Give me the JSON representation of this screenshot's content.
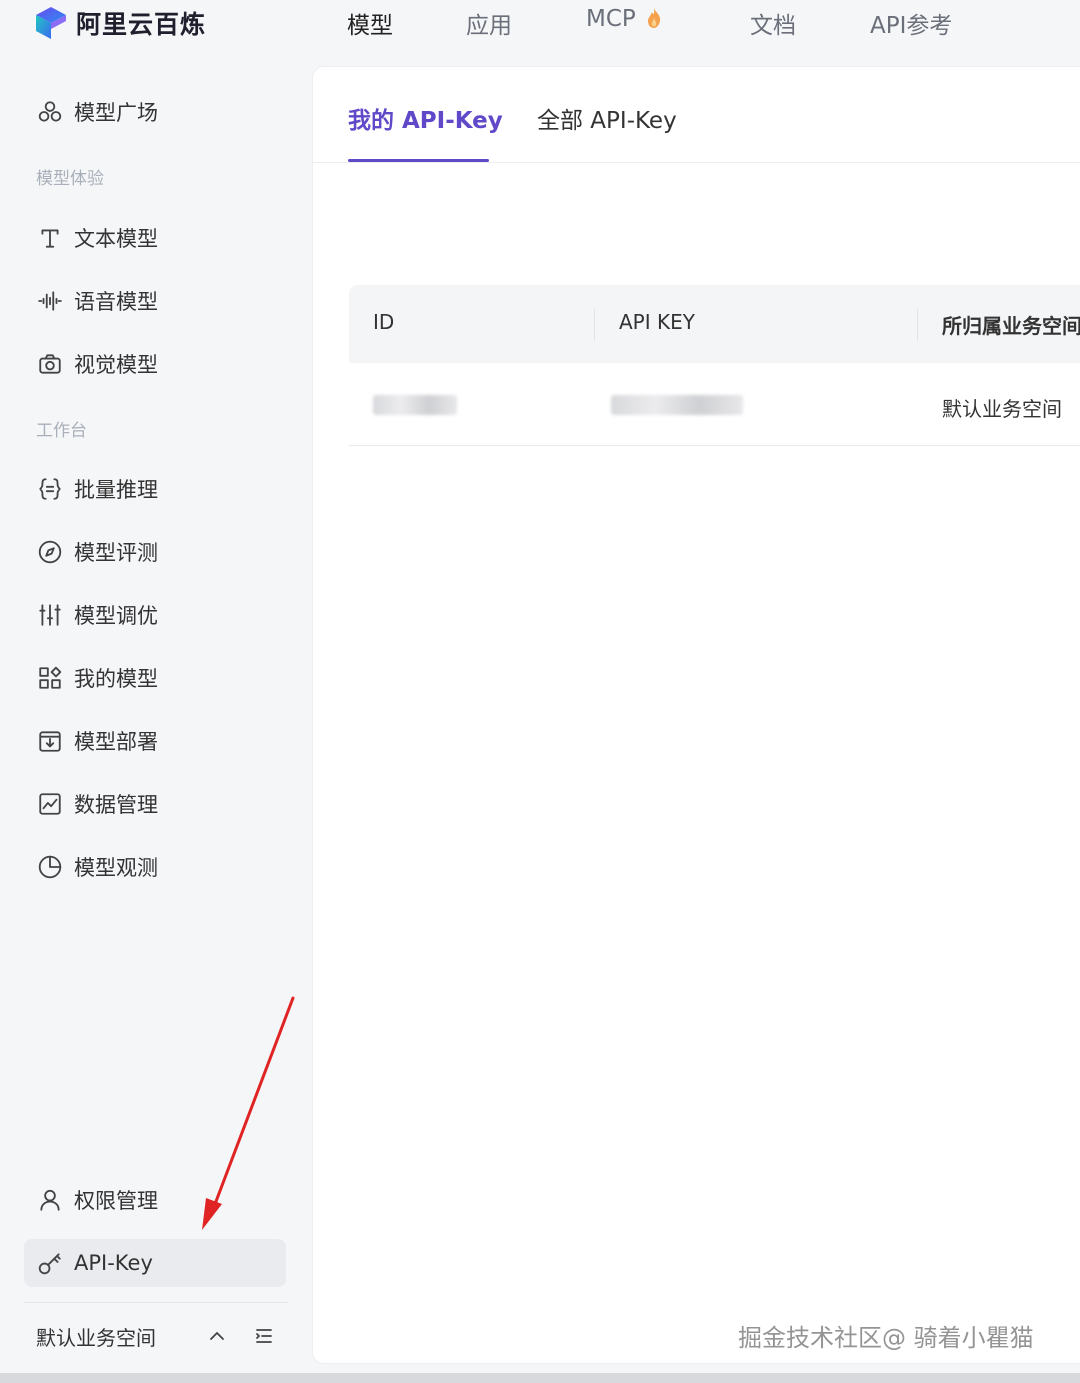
{
  "app": {
    "name": "阿里云百炼"
  },
  "top_nav": [
    {
      "label": "模型",
      "active": true
    },
    {
      "label": "应用",
      "active": false
    },
    {
      "label": "MCP",
      "active": false,
      "badge_icon": "flame-icon"
    },
    {
      "label": "文档",
      "active": false
    },
    {
      "label": "API参考",
      "active": false
    }
  ],
  "sidebar": {
    "top_item": {
      "label": "模型广场",
      "icon": "model-square-icon"
    },
    "group1": "模型体验",
    "group1_items": [
      {
        "label": "文本模型",
        "icon": "text-icon"
      },
      {
        "label": "语音模型",
        "icon": "audio-wave-icon"
      },
      {
        "label": "视觉模型",
        "icon": "camera-icon"
      }
    ],
    "group2": "工作台",
    "group2_items": [
      {
        "label": "批量推理",
        "icon": "braces-icon"
      },
      {
        "label": "模型评测",
        "icon": "compass-icon"
      },
      {
        "label": "模型调优",
        "icon": "sliders-icon"
      },
      {
        "label": "我的模型",
        "icon": "apps-icon"
      },
      {
        "label": "模型部署",
        "icon": "deploy-icon"
      },
      {
        "label": "数据管理",
        "icon": "chart-icon"
      },
      {
        "label": "模型观测",
        "icon": "pie-chart-icon"
      }
    ],
    "bottom_items": [
      {
        "label": "权限管理",
        "icon": "user-icon"
      },
      {
        "label": "API-Key",
        "icon": "key-icon",
        "selected": true
      }
    ],
    "workspace": "默认业务空间"
  },
  "main": {
    "tabs": [
      {
        "label": "我的 API-Key",
        "active": true
      },
      {
        "label": "全部 API-Key",
        "active": false
      }
    ],
    "table": {
      "headers": [
        "ID",
        "API KEY",
        "所归属业务空间"
      ],
      "rows": [
        {
          "id": "(blurred)",
          "api_key": "(blurred)",
          "workspace": "默认业务空间"
        }
      ]
    }
  },
  "watermark": "掘金技术社区@ 骑着小瞿猫",
  "colors": {
    "accent": "#6048c8",
    "arrow": "#e02424",
    "sidebar_bg": "#f5f6f8"
  }
}
